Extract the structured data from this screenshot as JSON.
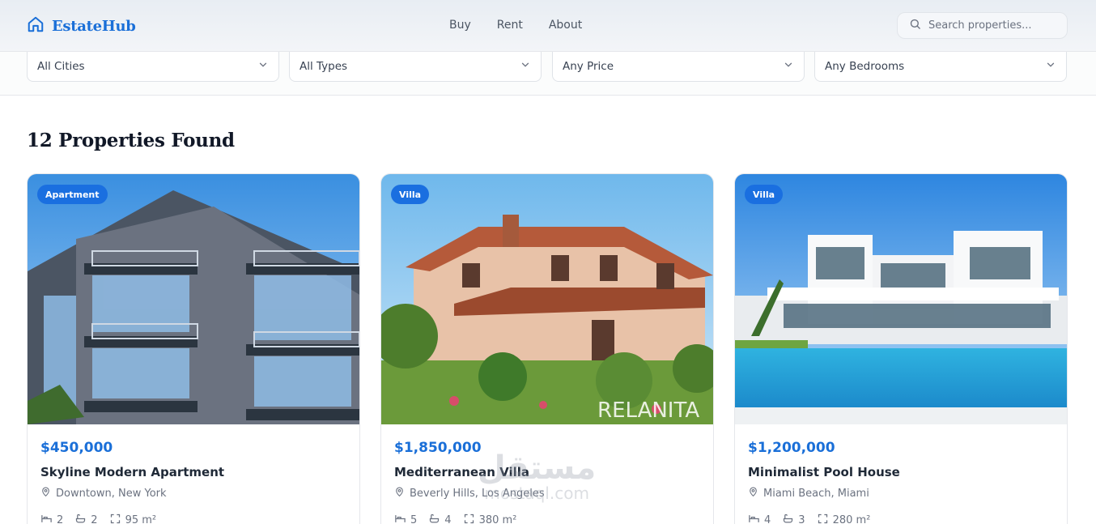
{
  "brand": {
    "name": "EstateHub",
    "icon": "home-icon",
    "color": "#1a6fd8"
  },
  "nav": [
    {
      "label": "Buy"
    },
    {
      "label": "Rent"
    },
    {
      "label": "About"
    }
  ],
  "search": {
    "placeholder": "Search properties...",
    "value": ""
  },
  "filters": [
    {
      "label": "All Cities"
    },
    {
      "label": "All Types"
    },
    {
      "label": "Any Price"
    },
    {
      "label": "Any Bedrooms"
    }
  ],
  "results": {
    "title": "12 Properties Found"
  },
  "listings": [
    {
      "badge": "Apartment",
      "price": "$450,000",
      "title": "Skyline Modern Apartment",
      "location": "Downtown, New York",
      "beds": "2",
      "baths": "2",
      "area": "95 m²"
    },
    {
      "badge": "Villa",
      "price": "$1,850,000",
      "title": "Mediterranean Villa",
      "location": "Beverly Hills, Los Angeles",
      "beds": "5",
      "baths": "4",
      "area": "380 m²",
      "image_text": "RELANITA"
    },
    {
      "badge": "Villa",
      "price": "$1,200,000",
      "title": "Minimalist Pool House",
      "location": "Miami Beach, Miami",
      "beds": "4",
      "baths": "3",
      "area": "280 m²"
    }
  ],
  "watermark": {
    "arabic": "مستقل",
    "latin": "mostaql.com"
  },
  "colors": {
    "accent": "#1a6fe0",
    "text": "#1f2937",
    "muted": "#6b7280"
  }
}
